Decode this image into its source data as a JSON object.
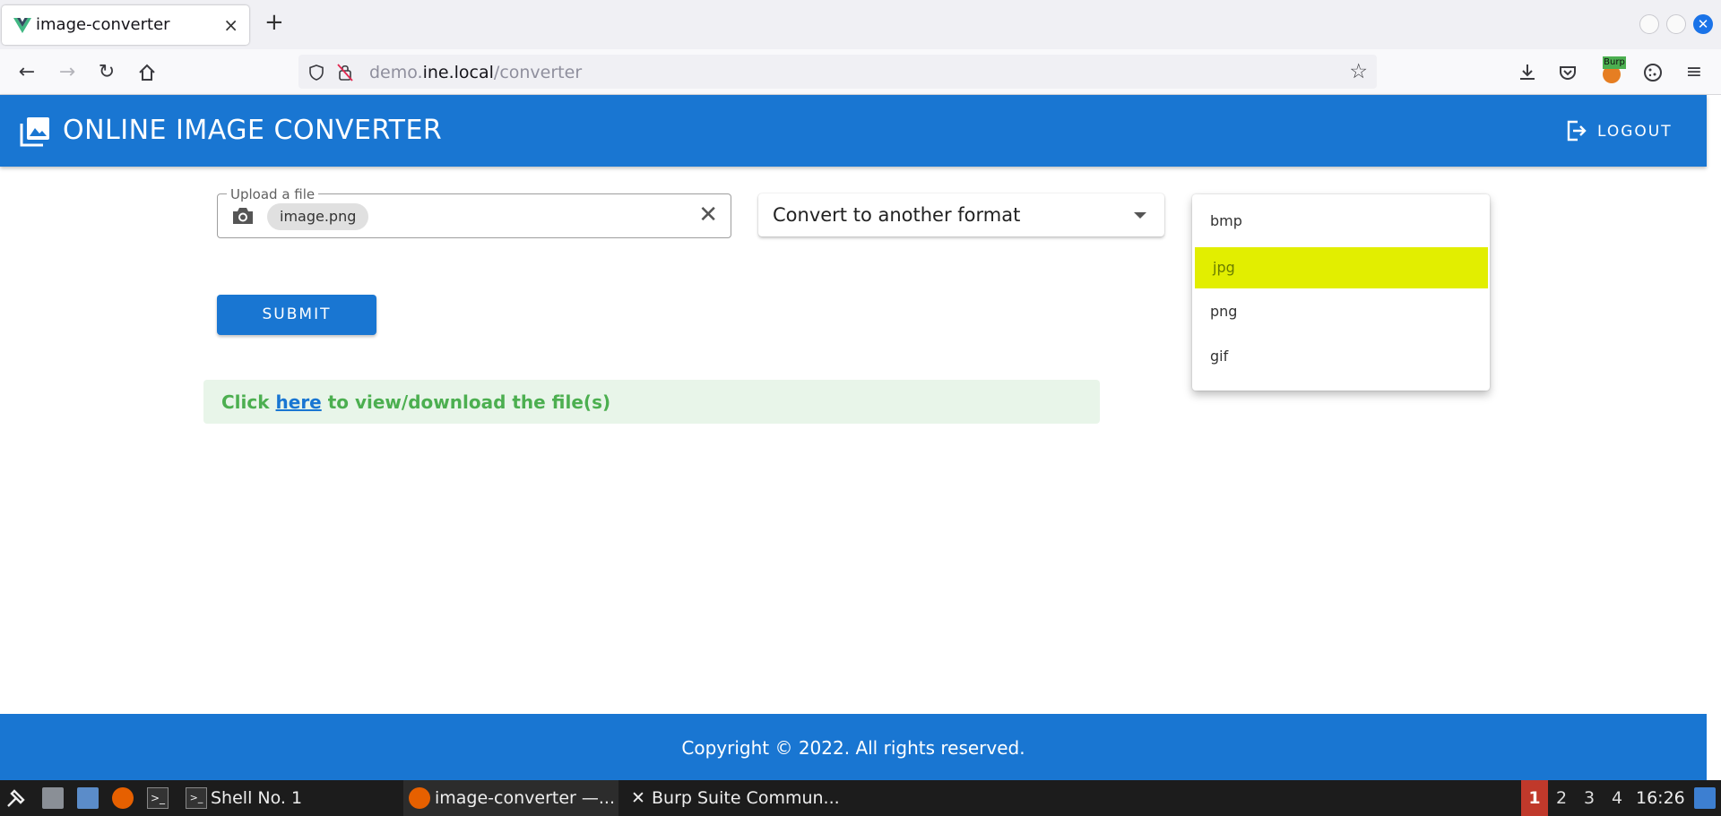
{
  "browser": {
    "tab_title": "image-converter",
    "tab_close": "×",
    "new_tab": "+",
    "url_scheme": "",
    "url_pre": "demo.",
    "url_host": "ine.local",
    "url_path": "/converter"
  },
  "app": {
    "title": "ONLINE IMAGE CONVERTER",
    "logout_label": "LOGOUT"
  },
  "form": {
    "upload_label": "Upload a file",
    "file_chip": "image.png",
    "format_select": "Convert to another format",
    "format_options": [
      "bmp",
      "jpg",
      "png",
      "gif"
    ],
    "highlighted_option": "jpg",
    "submit_label": "SUBMIT"
  },
  "alert": {
    "pre": "Click ",
    "link": "here",
    "post": " to view/download the file(s)"
  },
  "footer": {
    "copyright": "Copyright © 2022. All rights reserved."
  },
  "taskbar": {
    "shell": "Shell No. 1",
    "firefox_window": "image-converter —...",
    "burp_window": "Burp Suite Commun...",
    "workspaces": [
      "1",
      "2",
      "3",
      "4"
    ],
    "active_workspace": "1",
    "clock": "16:26"
  },
  "colors": {
    "primary": "#1976d2",
    "highlight": "#e2ee00",
    "success": "#4caf50"
  }
}
